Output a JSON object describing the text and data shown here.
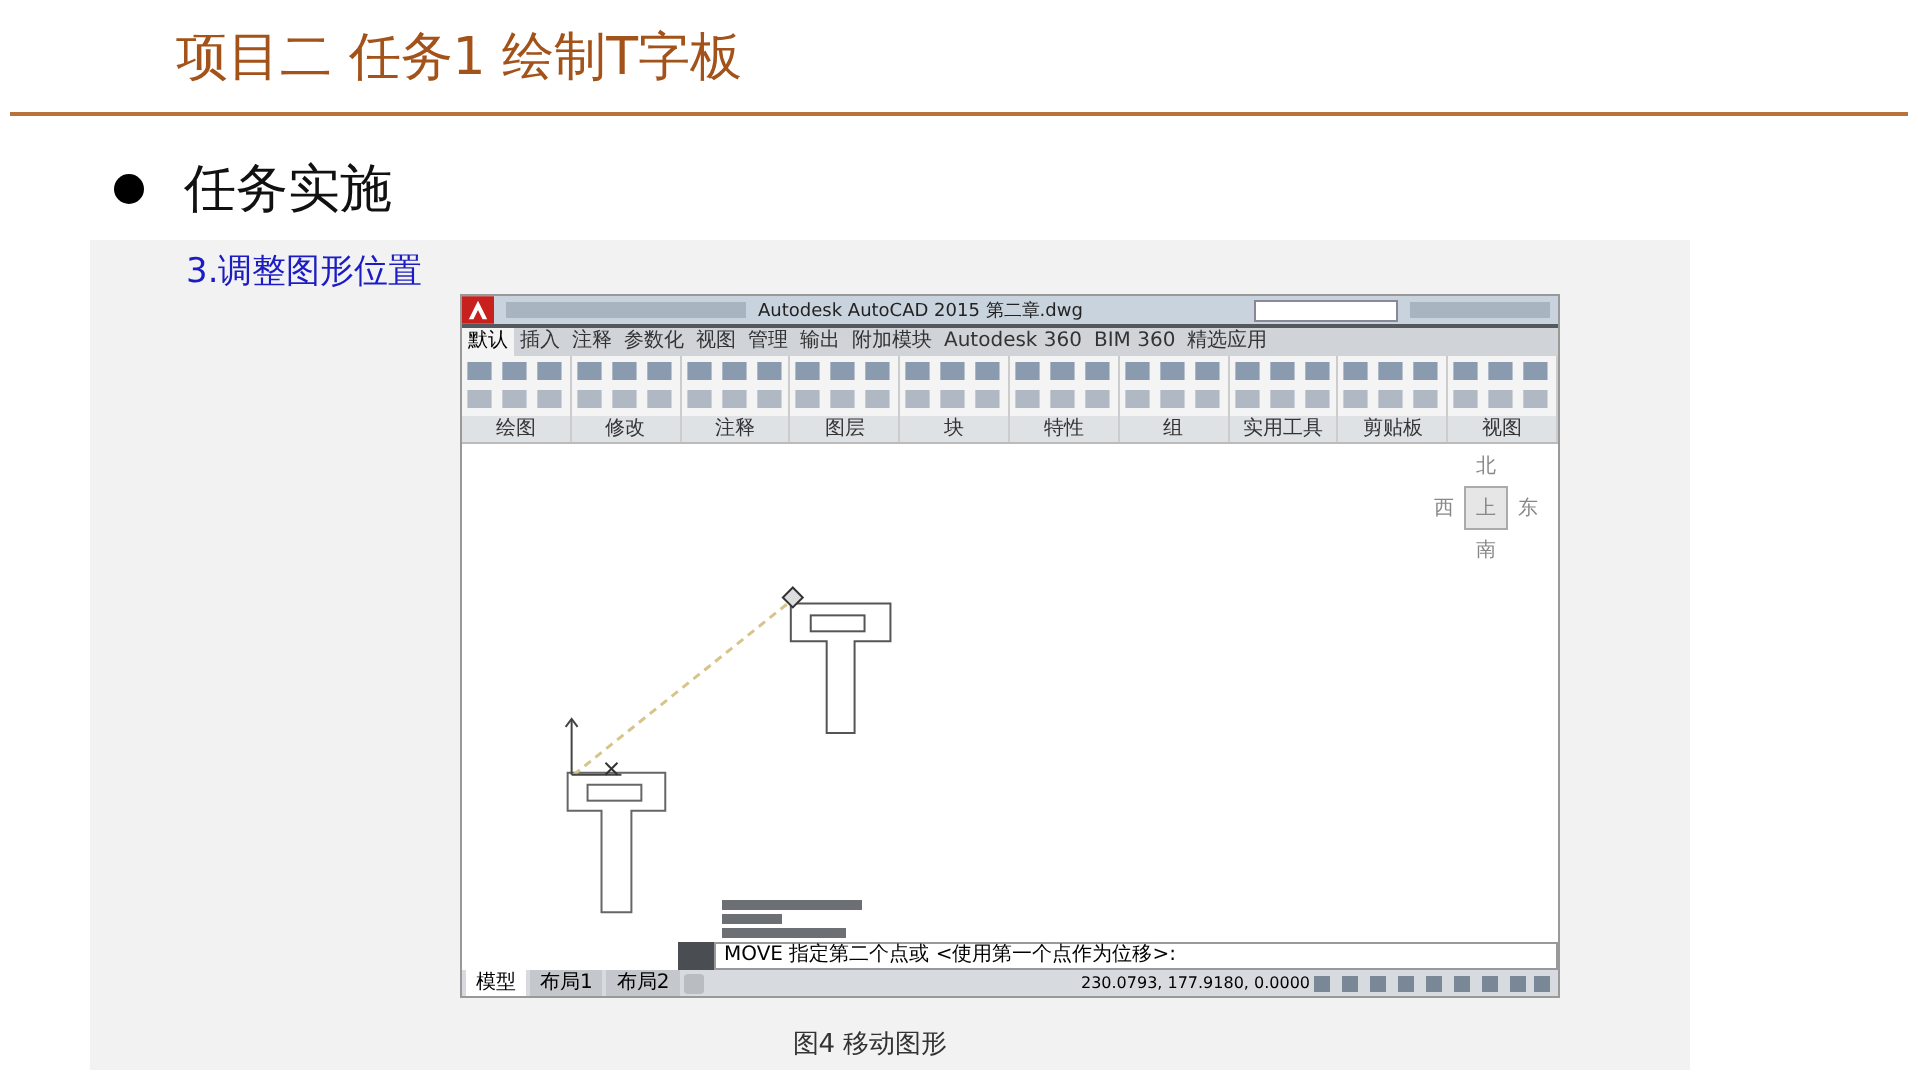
{
  "slide": {
    "title": "项目二 任务1  绘制T字板",
    "bullets": [
      {
        "text": "任务实施"
      }
    ]
  },
  "figure": {
    "step": "3.调整图形位置",
    "caption": "图4 移动图形",
    "app": {
      "title": "Autodesk AutoCAD 2015    第二章.dwg",
      "ribbon_tabs": [
        {
          "label": "默认",
          "selected": true
        },
        {
          "label": "插入",
          "selected": false
        },
        {
          "label": "注释",
          "selected": false
        },
        {
          "label": "参数化",
          "selected": false
        },
        {
          "label": "视图",
          "selected": false
        },
        {
          "label": "管理",
          "selected": false
        },
        {
          "label": "输出",
          "selected": false
        },
        {
          "label": "附加模块",
          "selected": false
        },
        {
          "label": "Autodesk 360",
          "selected": false
        },
        {
          "label": "BIM 360",
          "selected": false
        },
        {
          "label": "精选应用",
          "selected": false
        }
      ],
      "panels": [
        "绘图",
        "修改",
        "注释",
        "图层",
        "块",
        "特性",
        "组",
        "实用工具",
        "剪贴板",
        "视图"
      ],
      "viewcube": {
        "north": "北",
        "west": "西",
        "top": "上",
        "east": "东",
        "south": "南"
      },
      "command": "MOVE 指定第二个点或 <使用第一个点作为位移>:",
      "layout_tabs": [
        {
          "label": "模型",
          "selected": true
        },
        {
          "label": "布局1",
          "selected": false
        },
        {
          "label": "布局2",
          "selected": false
        }
      ],
      "coordinates": "230.0793, 177.9180, 0.0000"
    }
  }
}
